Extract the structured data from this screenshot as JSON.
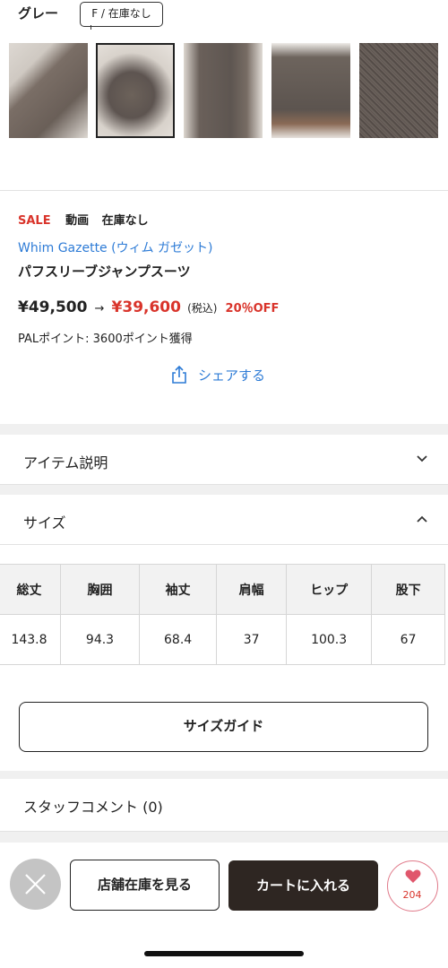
{
  "variant": {
    "color_name": "グレー",
    "size_chip": "F / 在庫なし"
  },
  "thumbnails": [
    {
      "name": "thumbnail-1",
      "selected": false
    },
    {
      "name": "thumbnail-2",
      "selected": true
    },
    {
      "name": "thumbnail-3",
      "selected": false
    },
    {
      "name": "thumbnail-4",
      "selected": false
    },
    {
      "name": "thumbnail-5",
      "selected": false
    }
  ],
  "product": {
    "badges": {
      "sale": "SALE",
      "video": "動画",
      "stock": "在庫なし"
    },
    "brand": "Whim Gazette (ウィム ガゼット)",
    "name": "パフスリーブジャンプスーツ",
    "price_original": "¥49,500",
    "price_arrow": "→",
    "price_sale": "¥39,600",
    "price_tax": "(税込)",
    "discount": "20％OFF",
    "points": "PALポイント: 3600ポイント獲得",
    "share_label": "シェアする"
  },
  "sections": {
    "item_description": "アイテム説明",
    "size": "サイズ",
    "staff_comment": "スタッフコメント (0)"
  },
  "size_table": {
    "headers": [
      "総丈",
      "胸囲",
      "袖丈",
      "肩幅",
      "ヒップ",
      "股下"
    ],
    "values": [
      "143.8",
      "94.3",
      "68.4",
      "37",
      "100.3",
      "67"
    ]
  },
  "size_guide_label": "サイズガイド",
  "bottom_bar": {
    "store_stock_label": "店舗在庫を見る",
    "add_to_cart_label": "カートに入れる",
    "favorite_count": "204"
  },
  "colors": {
    "sale_red": "#d9342b",
    "link_blue": "#2d7bd6",
    "cart_button": "#2e2622",
    "favorite_heart": "#e0576c"
  },
  "icons": [
    "share-icon",
    "chevron-down-icon",
    "chevron-up-icon",
    "close-icon",
    "heart-icon"
  ]
}
